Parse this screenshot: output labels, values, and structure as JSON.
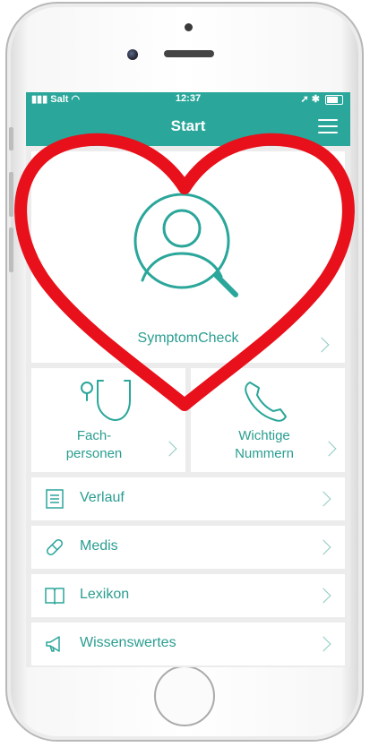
{
  "statusbar": {
    "carrier": "Salt",
    "time": "12:37"
  },
  "navbar": {
    "title": "Start"
  },
  "tiles": {
    "symptom_check": "SymptomCheck",
    "fach_line1": "Fach-",
    "fach_line2": "personen",
    "numbers_line1": "Wichtige",
    "numbers_line2": "Nummern"
  },
  "menu": {
    "items": [
      {
        "label": "Verlauf",
        "icon": "history-list-icon"
      },
      {
        "label": "Medis",
        "icon": "pill-icon"
      },
      {
        "label": "Lexikon",
        "icon": "book-icon"
      },
      {
        "label": "Wissenswertes",
        "icon": "megaphone-icon"
      }
    ]
  },
  "colors": {
    "accent": "#2aa69a",
    "text_accent": "#2a9d90",
    "heart_overlay": "#e8101a"
  }
}
